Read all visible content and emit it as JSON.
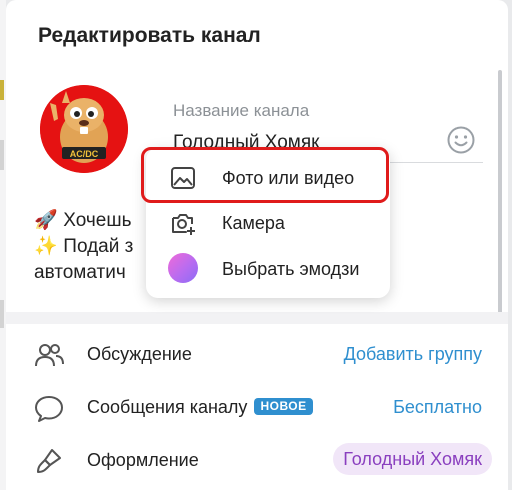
{
  "dialog": {
    "title": "Редактировать канал"
  },
  "channel": {
    "name_label": "Название канала",
    "name_value": "Голодный Хомяк",
    "description_lines": [
      {
        "emoji": "🚀",
        "text": "Хочешь"
      },
      {
        "emoji": "✨",
        "text": "Подай з"
      },
      {
        "emoji": "",
        "text": "автоматич"
      }
    ]
  },
  "photo_menu": {
    "items": [
      {
        "label": "Фото или видео",
        "icon": "image-icon"
      },
      {
        "label": "Камера",
        "icon": "camera-icon"
      },
      {
        "label": "Выбрать эмодзи",
        "icon": "emoji-gradient-icon"
      }
    ]
  },
  "settings": {
    "discussion": {
      "label": "Обсуждение",
      "value": "Добавить группу",
      "icon": "people-icon"
    },
    "messages": {
      "label": "Сообщения каналу",
      "badge": "НОВОЕ",
      "value": "Бесплатно",
      "icon": "chat-bubble-icon"
    },
    "appearance": {
      "label": "Оформление",
      "value": "Голодный Хомяк",
      "icon": "brush-icon"
    }
  },
  "colors": {
    "accent_blue": "#2f8fcf",
    "highlight_red": "#e01b1b",
    "avatar_red": "#e51212",
    "pill_bg": "#f1e6f8",
    "pill_text": "#8a3fbf"
  }
}
